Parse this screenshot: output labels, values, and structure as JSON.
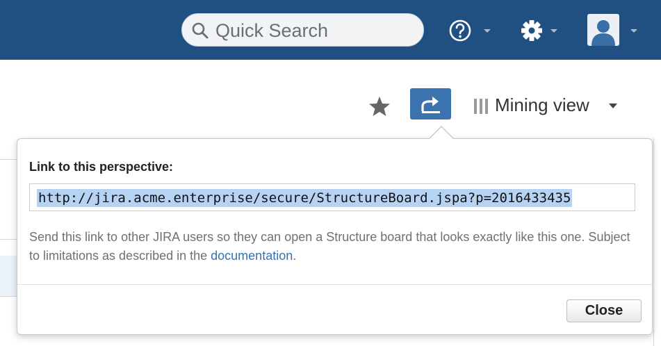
{
  "header": {
    "search": {
      "placeholder": "Quick Search",
      "icon": "search-icon"
    },
    "help_icon": "help-icon",
    "settings_icon": "gear-icon",
    "user_icon": "avatar",
    "brand_color": "#205081"
  },
  "toolbar": {
    "favorite_icon": "star-icon",
    "share_icon": "share-icon",
    "share_active_color": "#3b73af",
    "view_icon": "columns-icon",
    "view_label": "Mining view"
  },
  "popup": {
    "title": "Link to this perspective:",
    "url": "http://jira.acme.enterprise/secure/StructureBoard.jspa?p=2016433435",
    "description_before_link": "Send this link to other JIRA users so they can open a Structure board that looks exactly like this one. Subject to limitations as described in the ",
    "link_text": "documentation",
    "description_after_link": ".",
    "close_label": "Close",
    "link_color": "#3572b0"
  }
}
